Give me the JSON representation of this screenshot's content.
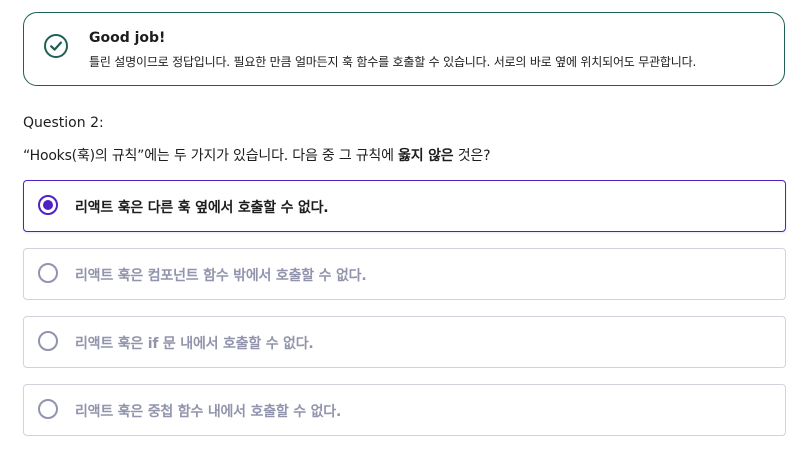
{
  "feedback": {
    "icon": "check-circle-icon",
    "title": "Good job!",
    "body": "틀린 설명이므로 정답입니다. 필요한 만큼 얼마든지 훅 함수를 호출할 수 있습니다. 서로의 바로 옆에 위치되어도 무관합니다.",
    "accent_color": "#1e6055"
  },
  "question": {
    "number_label": "Question 2:",
    "text_before": "“Hooks(훅)의 규칙”에는 두 가지가 있습니다. 다음 중 그 규칙에 ",
    "text_emphasis": "옳지 않은",
    "text_after": " 것은?"
  },
  "options": [
    {
      "label": "리액트 훅은 다른 훅 옆에서 호출할 수 없다.",
      "selected": true
    },
    {
      "label": "리액트 훅은 컴포넌트 함수 밖에서 호출할 수 없다.",
      "selected": false
    },
    {
      "label": "리액트 훅은 if 문 내에서 호출할 수 없다.",
      "selected": false
    },
    {
      "label": "리액트 훅은 중첩 함수 내에서 호출할 수 없다.",
      "selected": false
    }
  ],
  "colors": {
    "selected": "#5022c3",
    "unselected_text": "#9194ac",
    "border": "#d1d2e0"
  }
}
